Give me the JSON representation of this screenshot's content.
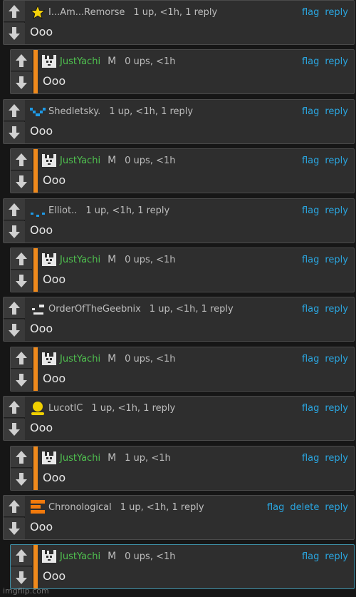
{
  "comments": [
    {
      "kind": "top",
      "avatar": "star-icon",
      "username": "I...Am...Remorse",
      "meta": "1 up, <1h, 1 reply",
      "actions": [
        "flag",
        "reply"
      ],
      "text": "Ooo"
    },
    {
      "kind": "reply",
      "avatar": "pixel-cat-icon",
      "username": "JustYachi",
      "mod": "M",
      "meta": "0 ups, <1h",
      "actions": [
        "flag",
        "reply"
      ],
      "text": "Ooo"
    },
    {
      "kind": "top",
      "avatar": "pixel-smile-icon",
      "username": "Shedletsky.",
      "meta": "1 up, <1h, 1 reply",
      "actions": [
        "flag",
        "reply"
      ],
      "text": "Ooo"
    },
    {
      "kind": "reply",
      "avatar": "pixel-cat-icon",
      "username": "JustYachi",
      "mod": "M",
      "meta": "0 ups, <1h",
      "actions": [
        "flag",
        "reply"
      ],
      "text": "Ooo"
    },
    {
      "kind": "top",
      "avatar": "pixel-dots-icon",
      "username": "Elliot..",
      "meta": "1 up, <1h, 1 reply",
      "actions": [
        "flag",
        "reply"
      ],
      "text": "Ooo"
    },
    {
      "kind": "reply",
      "avatar": "pixel-cat-icon",
      "username": "JustYachi",
      "mod": "M",
      "meta": "0 ups, <1h",
      "actions": [
        "flag",
        "reply"
      ],
      "text": "Ooo"
    },
    {
      "kind": "top",
      "avatar": "pixel-face-icon",
      "username": "OrderOfTheGeebnix",
      "meta": "1 up, <1h, 1 reply",
      "actions": [
        "flag",
        "reply"
      ],
      "text": "Ooo"
    },
    {
      "kind": "reply",
      "avatar": "pixel-cat-icon",
      "username": "JustYachi",
      "mod": "M",
      "meta": "0 ups, <1h",
      "actions": [
        "flag",
        "reply"
      ],
      "text": "Ooo"
    },
    {
      "kind": "top",
      "avatar": "person-icon",
      "username": "LucotIC",
      "meta": "1 up, <1h, 1 reply",
      "actions": [
        "flag",
        "reply"
      ],
      "text": "Ooo"
    },
    {
      "kind": "reply",
      "avatar": "pixel-cat-icon",
      "username": "JustYachi",
      "mod": "M",
      "meta": "1 up, <1h",
      "actions": [
        "flag",
        "reply"
      ],
      "text": "Ooo"
    },
    {
      "kind": "top",
      "avatar": "orange-glyph-icon",
      "username": "Chronological",
      "meta": "1 up, <1h, 1 reply",
      "actions": [
        "flag",
        "delete",
        "reply"
      ],
      "text": "Ooo"
    },
    {
      "kind": "reply",
      "avatar": "pixel-cat-icon",
      "username": "JustYachi",
      "mod": "M",
      "meta": "0 ups, <1h",
      "actions": [
        "flag",
        "reply"
      ],
      "text": "Ooo",
      "highlighted": true
    }
  ],
  "watermark": "imgflip.com",
  "colors": {
    "background": "#161616",
    "card": "#2e2e2e",
    "link": "#2aa6e0",
    "username_highlight": "#4fc04f",
    "reply_bar": "#f08a1c"
  }
}
